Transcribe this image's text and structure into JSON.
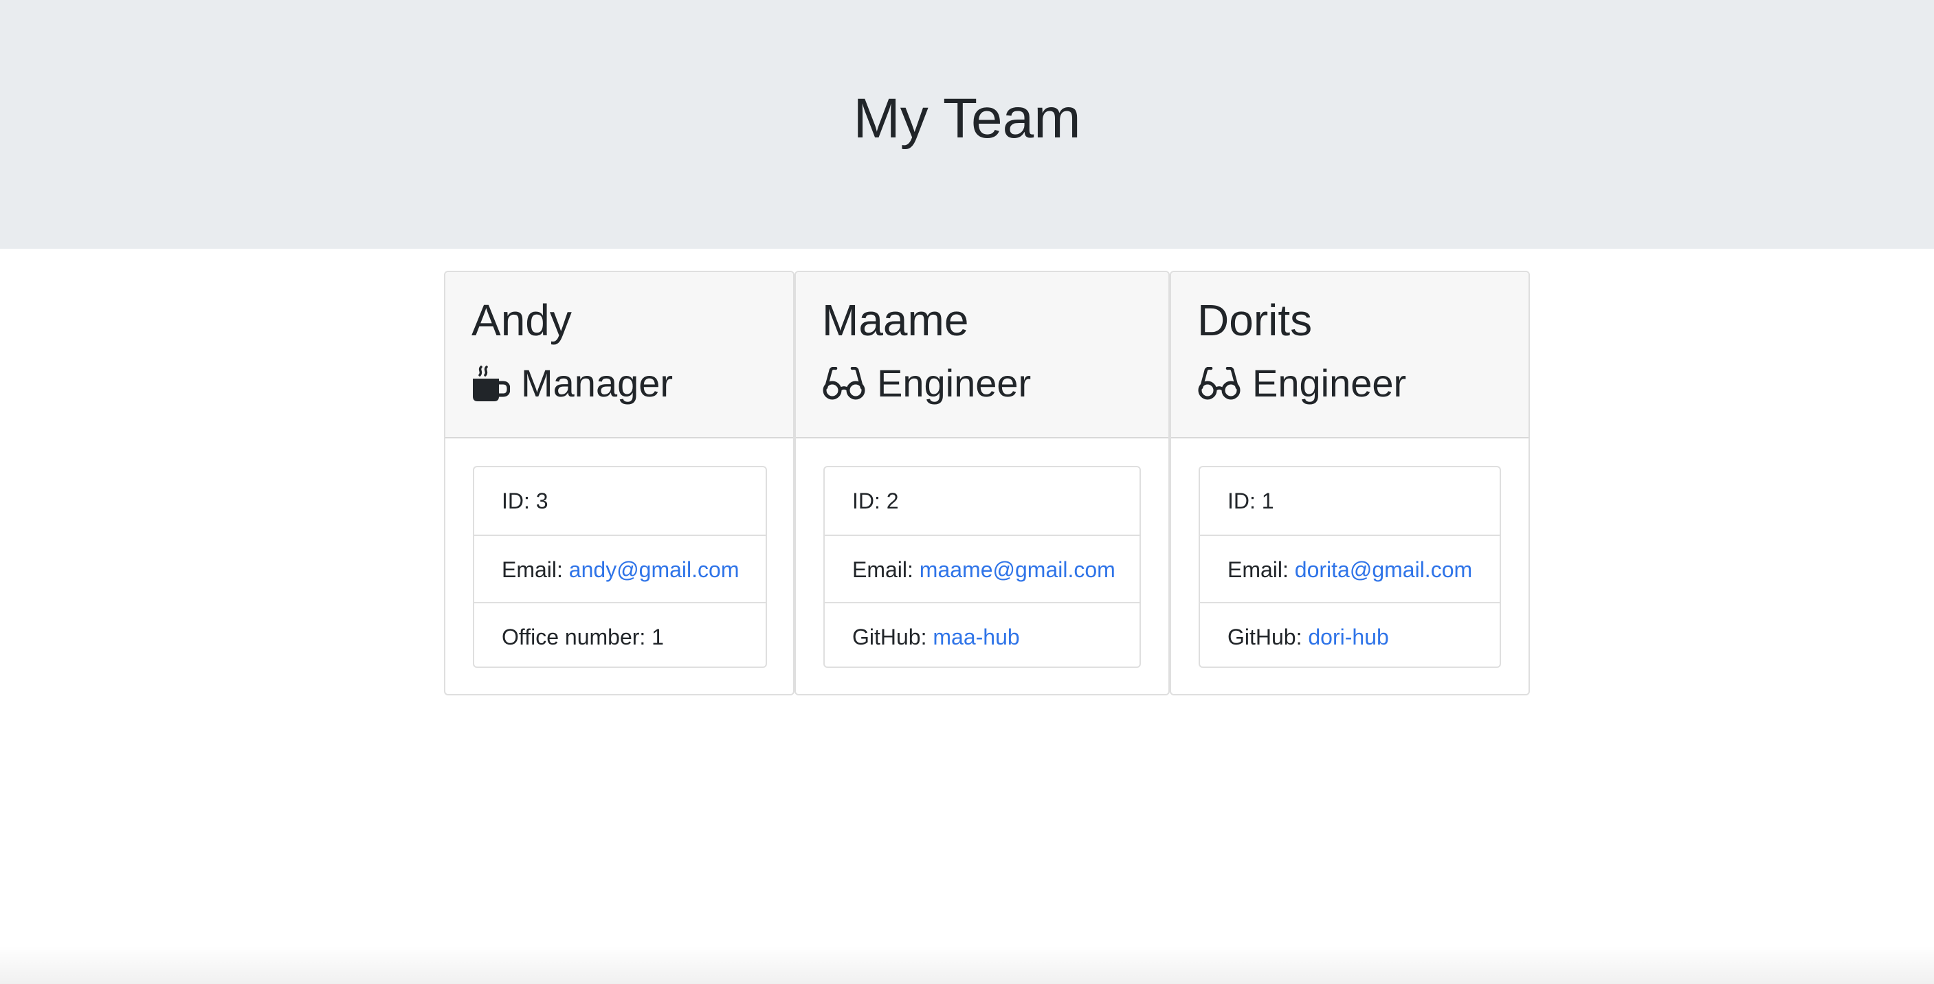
{
  "header": {
    "title": "My Team"
  },
  "colors": {
    "header_background": "#e9ecef",
    "card_header_background": "#f7f7f7",
    "link": "#2f74e8",
    "text": "#212529"
  },
  "team": [
    {
      "name": "Andy",
      "role": "Manager",
      "role_icon": "coffee-mug-icon",
      "id_text": "ID: 3",
      "email_label": "Email: ",
      "email": "andy@gmail.com",
      "extra_label": "Office number: ",
      "extra_value": "1",
      "extra_is_link": false
    },
    {
      "name": "Maame",
      "role": "Engineer",
      "role_icon": "glasses-icon",
      "id_text": "ID: 2",
      "email_label": "Email: ",
      "email": "maame@gmail.com",
      "extra_label": "GitHub: ",
      "extra_value": "maa-hub",
      "extra_is_link": true
    },
    {
      "name": "Dorits",
      "role": "Engineer",
      "role_icon": "glasses-icon",
      "id_text": "ID: 1",
      "email_label": "Email: ",
      "email": "dorita@gmail.com",
      "extra_label": "GitHub: ",
      "extra_value": "dori-hub",
      "extra_is_link": true
    }
  ]
}
